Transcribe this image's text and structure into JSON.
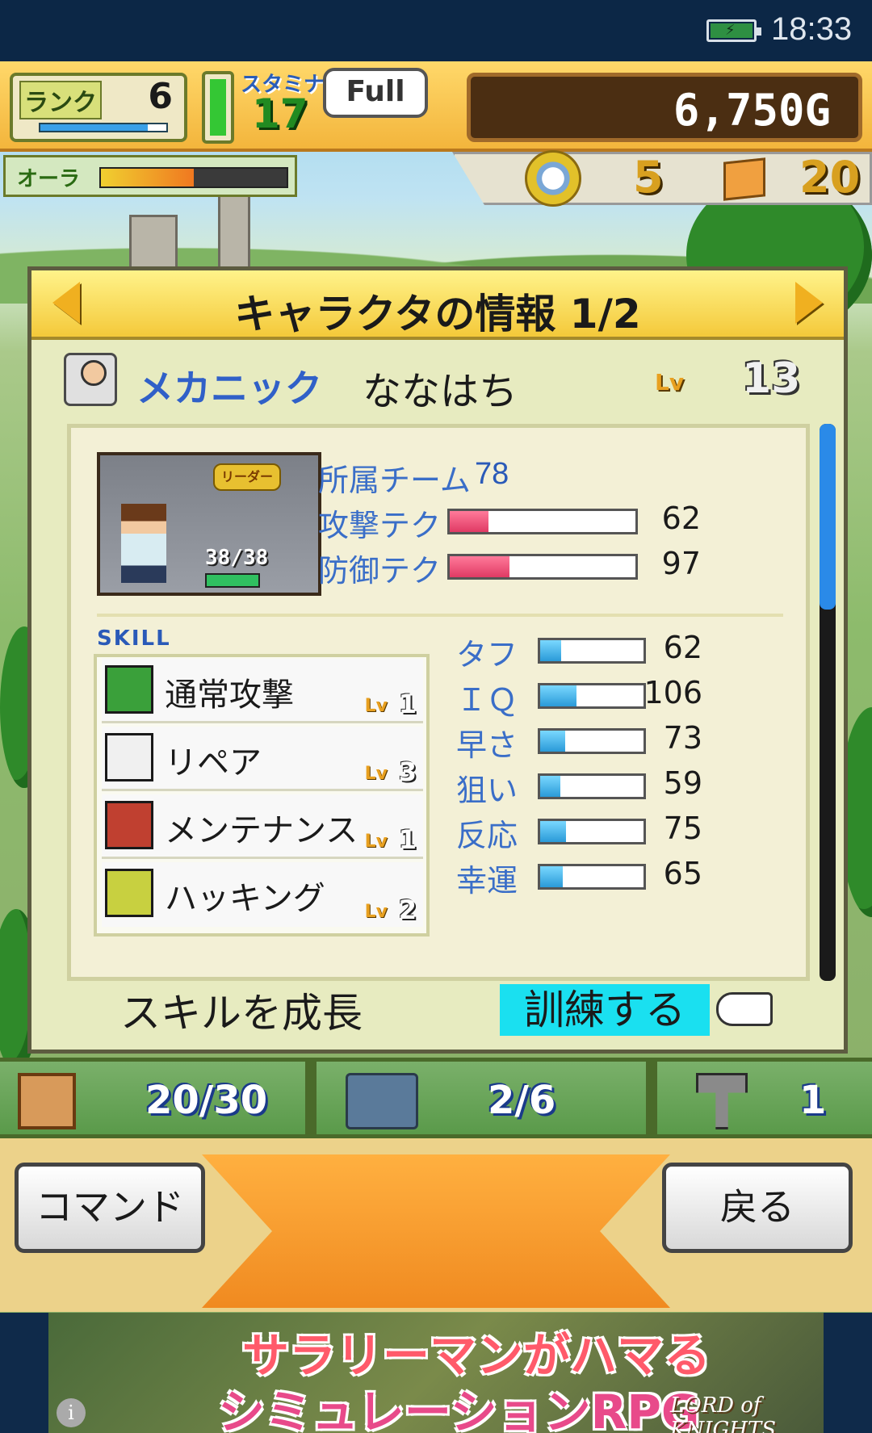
{
  "status_bar": {
    "time": "18:33",
    "battery_icon": "battery-charging-icon"
  },
  "hud": {
    "rank_label": "ランク",
    "rank_value": "6",
    "rank_progress": 0.85,
    "stamina_label": "スタミナ",
    "stamina_value": "17",
    "stamina_level": 1.0,
    "full_label": "Full",
    "gold": "6,750G",
    "aura_label": "オーラ",
    "aura_level": 0.5,
    "medals": "5",
    "boxes": "20"
  },
  "panel": {
    "title": "キャラクタの情報 1/2",
    "prev_icon": "arrow-left-icon",
    "next_icon": "arrow-right-icon",
    "job": "メカニック",
    "name": "ななはち",
    "lv_label": "Lv",
    "level": "13",
    "portrait": {
      "leader_badge": "リーダー",
      "hp": "38/38",
      "hp_fraction": 1.0
    },
    "team_label": "所属チーム",
    "team_value": "78",
    "attack_label": "攻撃テク",
    "attack_value": "62",
    "defense_label": "防御テク",
    "defense_value": "97",
    "skill_title": "SKILL",
    "skills": [
      {
        "name": "通常攻撃",
        "lv_label": "Lv",
        "lv": "1",
        "icon": "sword-attack-icon"
      },
      {
        "name": "リペア",
        "lv_label": "Lv",
        "lv": "3",
        "icon": "repair-kit-icon"
      },
      {
        "name": "メンテナンス",
        "lv_label": "Lv",
        "lv": "1",
        "icon": "wrench-tools-icon"
      },
      {
        "name": "ハッキング",
        "lv_label": "Lv",
        "lv": "2",
        "icon": "laptop-hacking-icon"
      }
    ],
    "stats": [
      {
        "label": "タフ",
        "value": "62"
      },
      {
        "label": "ＩＱ",
        "value": "106"
      },
      {
        "label": "早さ",
        "value": "73"
      },
      {
        "label": "狙い",
        "value": "59"
      },
      {
        "label": "反応",
        "value": "75"
      },
      {
        "label": "幸運",
        "value": "65"
      }
    ],
    "grow_label": "スキルを成長",
    "train_button": "訓練する",
    "hand_icon": "pointing-hand-icon"
  },
  "resources": [
    {
      "icon": "crate-icon",
      "value": "20/30"
    },
    {
      "icon": "airplane-icon",
      "value": "2/6"
    },
    {
      "icon": "hammer-icon",
      "value": "1"
    }
  ],
  "commands": {
    "command_button": "コマンド",
    "back_button": "戻る"
  },
  "ad": {
    "line1": "サラリーマンがハマる",
    "line2": "シミュレーションRPG",
    "logo": "LORD of KNIGHTS",
    "info_icon": "info-icon"
  }
}
